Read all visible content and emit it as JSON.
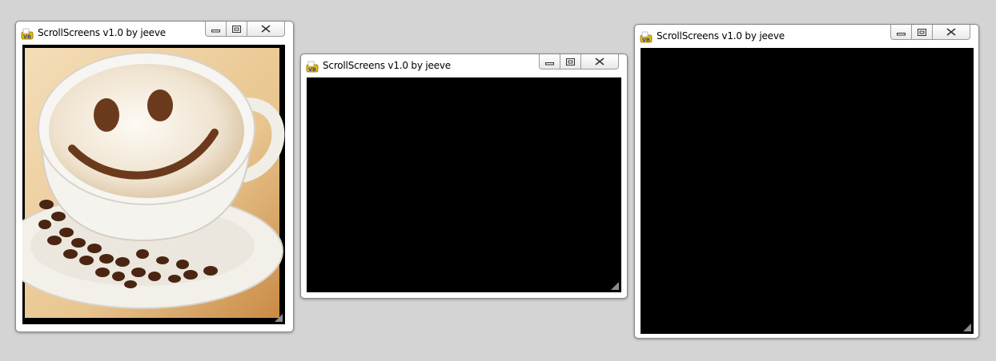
{
  "windows": [
    {
      "title": "ScrollScreens v1.0 by jeeve",
      "content": "coffee-image"
    },
    {
      "title": "ScrollScreens v1.0 by jeeve",
      "content": "black"
    },
    {
      "title": "ScrollScreens v1.0 by jeeve",
      "content": "black"
    }
  ],
  "icons": {
    "app": "app-icon",
    "minimize": "minimize-icon",
    "maximize": "maximize-icon",
    "close": "close-icon",
    "resize": "resize-grip-icon"
  },
  "colors": {
    "desktop": "#d4d4d4",
    "client_background": "#000000",
    "title_text": "#000000"
  }
}
